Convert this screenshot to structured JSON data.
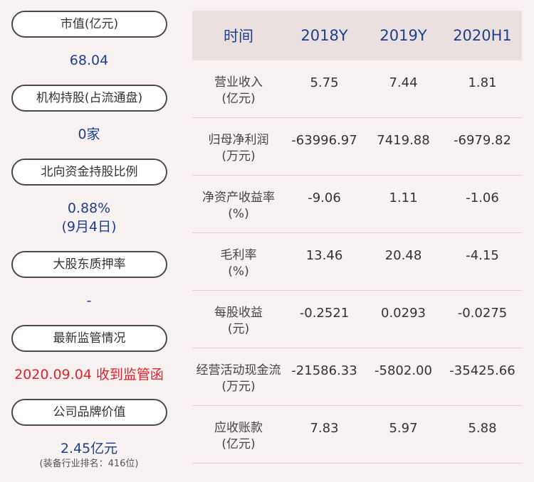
{
  "left": {
    "items": [
      {
        "label": "市值(亿元)",
        "value": "68.04"
      },
      {
        "label": "机构持股(占流通盘)",
        "value": "0家"
      },
      {
        "label": "北向资金持股比例",
        "value": "0.88%",
        "value2": "(9月4日)"
      },
      {
        "label": "大股东质押率",
        "value": "-"
      },
      {
        "label": "最新监管情况",
        "value": "2020.09.04 收到监管函"
      },
      {
        "label": "公司品牌价值",
        "value": "2.45亿元",
        "note": "(装备行业排名：416位)"
      }
    ]
  },
  "table": {
    "headers": [
      "时间",
      "2018Y",
      "2019Y",
      "2020H1"
    ],
    "rows": [
      {
        "label": "营业收入",
        "unit": "(亿元)",
        "values": [
          "5.75",
          "7.44",
          "1.81"
        ]
      },
      {
        "label": "归母净利润",
        "unit": "(万元)",
        "values": [
          "-63996.97",
          "7419.88",
          "-6979.82"
        ]
      },
      {
        "label": "净资产收益率",
        "unit": "(%)",
        "values": [
          "-9.06",
          "1.11",
          "-1.06"
        ]
      },
      {
        "label": "毛利率",
        "unit": "(%)",
        "values": [
          "13.46",
          "20.48",
          "-4.15"
        ]
      },
      {
        "label": "每股收益",
        "unit": "(元)",
        "values": [
          "-0.2521",
          "0.0293",
          "-0.0275"
        ]
      },
      {
        "label": "经营活动现金流",
        "unit": "(万元)",
        "values": [
          "-21586.33",
          "-5802.00",
          "-35425.66"
        ]
      },
      {
        "label": "应收账款",
        "unit": "(亿元)",
        "values": [
          "7.83",
          "5.97",
          "5.88"
        ]
      }
    ]
  },
  "colors": {
    "accent": "#1e3f8c",
    "alert": "#e0232a",
    "background": "#f8f1f1",
    "header_bg": "#ebe0e0"
  }
}
